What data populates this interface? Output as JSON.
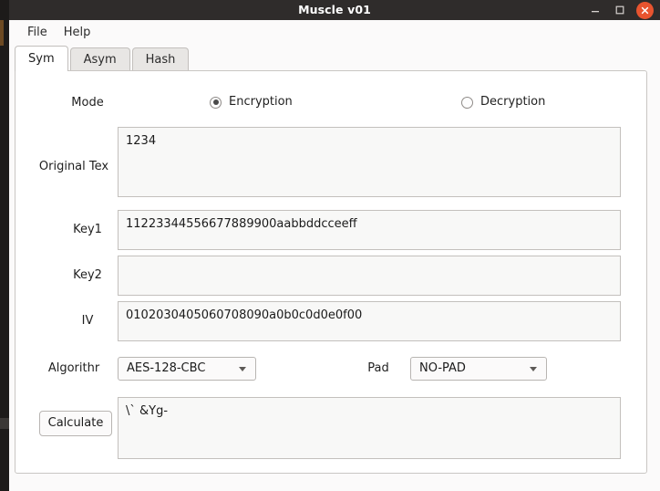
{
  "window": {
    "title": "Muscle v01",
    "controls": {
      "minimize": "minimize-icon",
      "maximize": "maximize-icon",
      "close": "✕"
    }
  },
  "menubar": {
    "items": [
      {
        "label": "File"
      },
      {
        "label": "Help"
      }
    ]
  },
  "tabs": [
    {
      "label": "Sym",
      "active": true
    },
    {
      "label": "Asym",
      "active": false
    },
    {
      "label": "Hash",
      "active": false
    }
  ],
  "form": {
    "mode": {
      "label": "Mode",
      "options": [
        {
          "label": "Encryption",
          "selected": true
        },
        {
          "label": "Decryption",
          "selected": false
        }
      ]
    },
    "original_text": {
      "label": "Original Tex",
      "value": "1234",
      "placeholder": ""
    },
    "key1": {
      "label": "Key1",
      "value": "11223344556677889900aabbddcceeff",
      "placeholder": ""
    },
    "key2": {
      "label": "Key2",
      "value": "",
      "placeholder": ""
    },
    "iv": {
      "label": "IV",
      "value": "0102030405060708090a0b0c0d0e0f00",
      "placeholder": ""
    },
    "algorithm": {
      "label": "Algorithr",
      "value": "AES-128-CBC"
    },
    "pad": {
      "label": "Pad",
      "value": "NO-PAD"
    },
    "calculate": {
      "label": "Calculate"
    },
    "result": {
      "value": "\\` &Yg-",
      "placeholder": ""
    }
  },
  "colors": {
    "titlebar_bg": "#2f2c2b",
    "close_button": "#e8542f",
    "panel_bg": "#ffffff",
    "field_bg": "#f8f8f7",
    "border": "#c3c0bd"
  }
}
